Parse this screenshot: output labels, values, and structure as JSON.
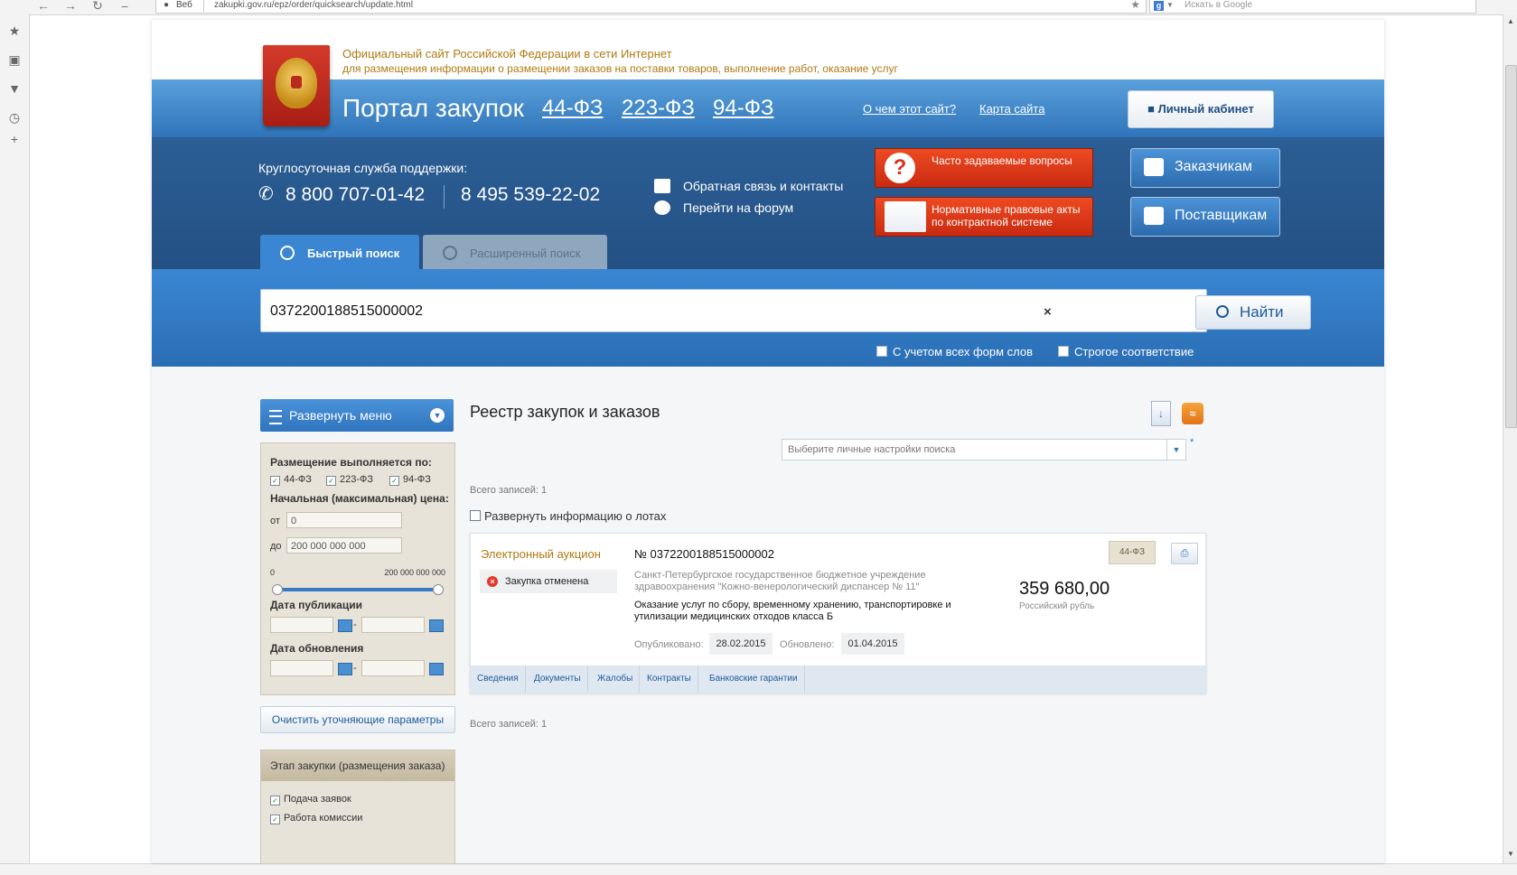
{
  "browser": {
    "web_label": "Веб",
    "url": "zakupki.gov.ru/epz/order/quicksearch/update.html",
    "search_placeholder": "Искать в Google"
  },
  "site": {
    "official_line1": "Официальный сайт Российской Федерации в сети Интернет",
    "official_line2": "для размещения информации о размещении заказов на поставки товаров, выполнение работ, оказание услуг",
    "title": "Портал закупок",
    "laws": [
      "44-ФЗ",
      "223-ФЗ",
      "94-ФЗ"
    ],
    "about_link": "О чем этот сайт?",
    "sitemap_link": "Карта сайта",
    "cabinet": "Личный кабинет"
  },
  "support": {
    "label": "Круглосуточная служба поддержки:",
    "phone1": "8 800 707-01-42",
    "phone2": "8 495 539-22-02",
    "feedback": "Обратная связь и контакты",
    "forum": "Перейти на форум"
  },
  "promo": {
    "faq": "Часто задаваемые вопросы",
    "acts": "Нормативные правовые акты по контрактной системе",
    "customers": "Заказчикам",
    "suppliers": "Поставщикам"
  },
  "tabs": {
    "quick": "Быстрый поиск",
    "advanced": "Расширенный поиск"
  },
  "search": {
    "value": "0372200188515000002",
    "find": "Найти",
    "all_forms": "С учетом всех форм слов",
    "strict": "Строгое соответствие"
  },
  "sidebar": {
    "expand_menu": "Развернуть меню",
    "placement_by": "Размещение выполняется по:",
    "laws": [
      "44-ФЗ",
      "223-ФЗ",
      "94-ФЗ"
    ],
    "price_label": "Начальная (максимальная) цена:",
    "from_label": "от",
    "to_label": "до",
    "price_from": "0",
    "price_to": "200 000 000 000",
    "range_min": "0",
    "range_max": "200 000 000 000",
    "pub_date": "Дата публикации",
    "upd_date": "Дата обновления",
    "dash": "-",
    "clear": "Очистить уточняющие параметры",
    "stage_title": "Этап закупки (размещения заказа)",
    "stage_items": [
      "Подача заявок",
      "Работа комиссии"
    ]
  },
  "registry": {
    "title": "Реестр закупок и заказов",
    "settings_placeholder": "Выберите личные настройки поиска",
    "asterisk": "*",
    "total": "Всего записей: 1",
    "expand_lots": "Развернуть информацию о лотах"
  },
  "card": {
    "type": "Электронный аукцион",
    "status": "Закупка отменена",
    "number": "№ 0372200188515000002",
    "customer": "Санкт-Петербургское государственное бюджетное учреждение здравоохранения \"Кожно-венерологический диспансер № 11\"",
    "subject": "Оказание услуг по сбору, временному хранению, транспортировке и утилизации медицинских отходов класса Б",
    "price": "359 680,00",
    "currency": "Российский рубль",
    "law": "44-ФЗ",
    "published_label": "Опубликовано:",
    "published": "28.02.2015",
    "updated_label": "Обновлено:",
    "updated": "01.04.2015",
    "tabs": [
      "Сведения",
      "Документы",
      "Жалобы",
      "Контракты",
      "Банковские гарантии"
    ]
  },
  "colors": {
    "header_blue": "#2f74b9",
    "band_blue": "#234f82",
    "accent_orange": "#b07a12",
    "faq_red": "#d8321b"
  }
}
